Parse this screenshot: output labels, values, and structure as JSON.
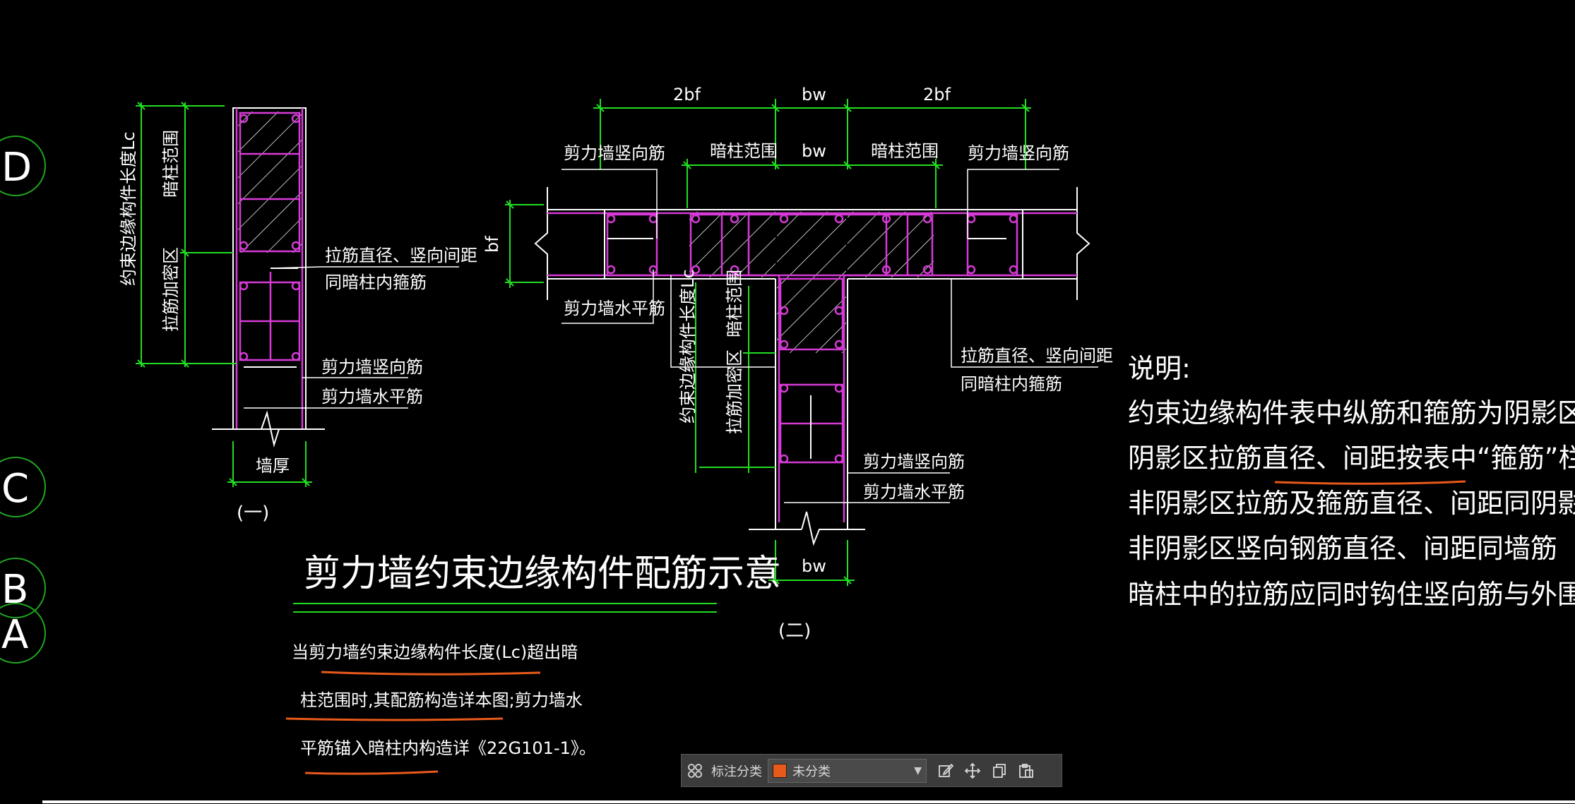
{
  "grid_bubbles": [
    "D",
    "C",
    "B",
    "A"
  ],
  "detail1": {
    "label_core": "暗柱范围",
    "label_length": "约束边缘构件长度Lc",
    "label_densify": "拉筋加密区",
    "callout_tie_1": "拉筋直径、竖向间距",
    "callout_tie_2": "同暗柱内箍筋",
    "callout_vert": "剪力墙竖向筋",
    "callout_horiz": "剪力墙水平筋",
    "dim_thickness": "墙厚",
    "caption": "(一)"
  },
  "detail2": {
    "dim_top_left": "2bf",
    "dim_top_mid": "bw",
    "dim_top_right": "2bf",
    "dim_mid": "bw",
    "label_core_left": "暗柱范围",
    "label_core_right": "暗柱范围",
    "callout_vert_left": "剪力墙竖向筋",
    "callout_vert_right": "剪力墙竖向筋",
    "dim_flange": "bf",
    "callout_horiz_top": "剪力墙水平筋",
    "label_length": "约束边缘构件长度Lc",
    "label_core_stem": "暗柱范围",
    "label_densify": "拉筋加密区",
    "callout_tie_1": "拉筋直径、竖向间距",
    "callout_tie_2": "同暗柱内箍筋",
    "callout_vert": "剪力墙竖向筋",
    "callout_horiz": "剪力墙水平筋",
    "dim_bottom": "bw",
    "caption": "(二)"
  },
  "title": "剪力墙约束边缘构件配筋示意",
  "remark_lines": [
    "当剪力墙约束边缘构件长度(Lc)超出暗",
    "柱范围时,其配筋构造详本图;剪力墙水",
    "平筋锚入暗柱内构造详《22G101-1》。"
  ],
  "notes": {
    "heading": "说明:",
    "lines": [
      "约束边缘构件表中纵筋和箍筋为阴影区配筋",
      "阴影区拉筋直径、间距按表中“箍筋”栏配置",
      "非阴影区拉筋及箍筋直径、间距同阴影区",
      "非阴影区竖向钢筋直径、间距同墙筋",
      "暗柱中的拉筋应同时钩住竖向筋与外围水平箍筋"
    ]
  },
  "toolbar": {
    "grid_icon": "grid-icon",
    "label": "标注分类",
    "selected": "未分类",
    "swatch_color": "#e85a1a"
  },
  "colors": {
    "outline": "#ffffff",
    "rebar": "#d63bd6",
    "dimension": "#22dd22",
    "highlight": "#e85a1a"
  }
}
